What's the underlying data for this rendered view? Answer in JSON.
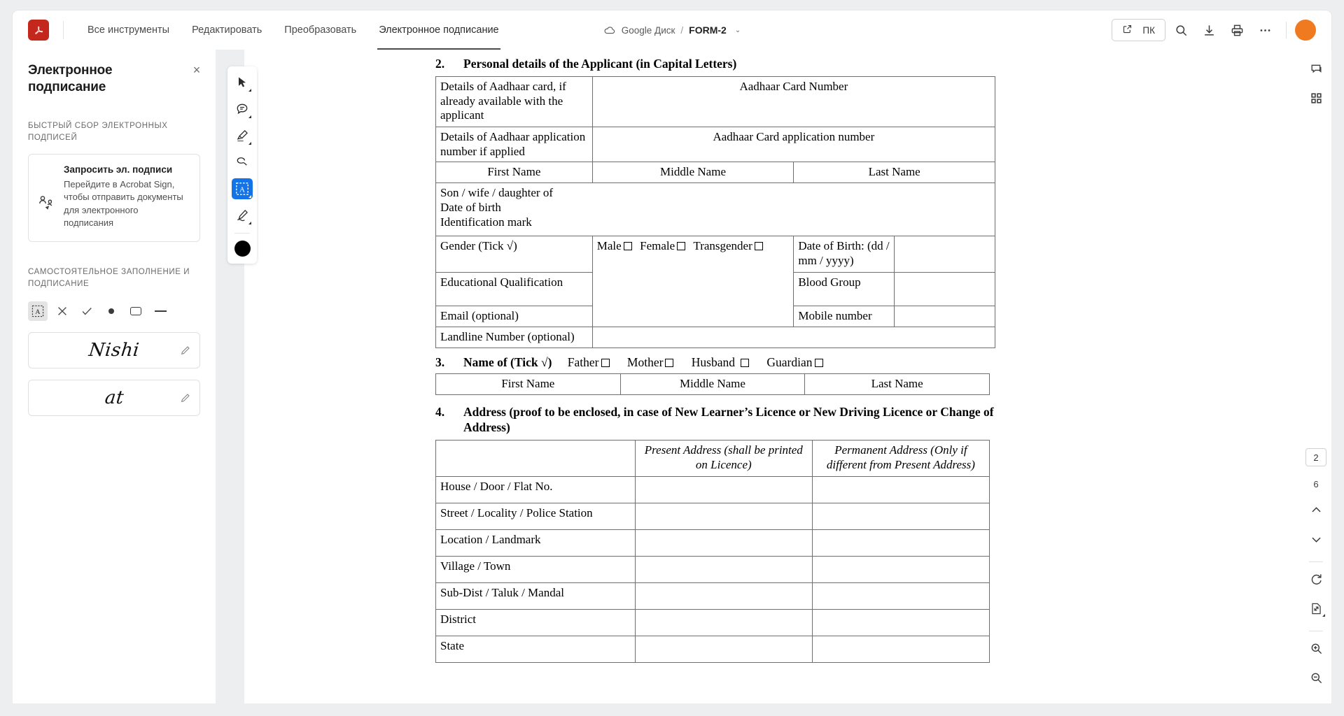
{
  "app": {
    "logo_icon": "acrobat-logo",
    "nav_tabs": [
      {
        "label": "Все инструменты",
        "active": false
      },
      {
        "label": "Редактировать",
        "active": false
      },
      {
        "label": "Преобразовать",
        "active": false
      },
      {
        "label": "Электронное подписание",
        "active": true
      }
    ]
  },
  "breadcrumb": {
    "cloud_icon": "cloud-icon",
    "storage": "Google Диск",
    "separator": "/",
    "filename": "FORM-2",
    "caret": "⌄"
  },
  "toolbar_right": {
    "share_label": "ПК",
    "share_icon": "external-link-icon",
    "search_icon": "search-icon",
    "download_icon": "download-icon",
    "print_icon": "print-icon",
    "more_icon": "more-options-icon",
    "avatar": "user-avatar"
  },
  "left_panel": {
    "title": "Электронное подписание",
    "close_label": "×",
    "section1_title": "БЫСТРЫЙ СБОР ЭЛЕКТРОННЫХ ПОДПИСЕЙ",
    "request_card": {
      "icon": "request-signatures-icon",
      "title": "Запросить эл. подписи",
      "description": "Перейдите в Acrobat Sign, чтобы отправить документы для электронного подписания"
    },
    "section2_title": "САМОСТОЯТЕЛЬНОЕ ЗАПОЛНЕНИЕ И ПОДПИСАНИЕ",
    "fill_tools": [
      {
        "name": "add-text-tool",
        "glyph": "A",
        "active": true
      },
      {
        "name": "cross-mark-tool",
        "glyph": "✕",
        "active": false
      },
      {
        "name": "check-mark-tool",
        "glyph": "✓",
        "active": false
      },
      {
        "name": "dot-tool",
        "glyph": "•",
        "active": false
      },
      {
        "name": "rectangle-tool",
        "glyph": "▭",
        "active": false
      },
      {
        "name": "line-tool",
        "glyph": "—",
        "active": false
      }
    ],
    "signatures": [
      {
        "text": "Nishi",
        "edit_icon": "pencil-icon"
      },
      {
        "text": "at",
        "edit_icon": "pencil-icon"
      }
    ]
  },
  "vertical_toolbar": [
    {
      "name": "select-tool",
      "icon": "cursor-arrow-icon",
      "active": false,
      "has_dropdown": true
    },
    {
      "name": "comment-tool",
      "icon": "comment-bubble-icon",
      "active": false,
      "has_dropdown": true
    },
    {
      "name": "highlight-tool",
      "icon": "highlighter-icon",
      "active": false,
      "has_dropdown": true
    },
    {
      "name": "erase-tool",
      "icon": "lasso-eraser-icon",
      "active": false,
      "has_dropdown": false
    },
    {
      "name": "add-text-tool",
      "icon": "text-box-icon",
      "active": true,
      "has_dropdown": true
    },
    {
      "name": "sign-tool",
      "icon": "fountain-pen-icon",
      "active": false,
      "has_dropdown": true
    },
    {
      "name": "color-swatch",
      "icon": "color-circle",
      "active": false,
      "has_dropdown": false,
      "color": "#000000"
    }
  ],
  "right_rail": {
    "top_icons": [
      {
        "name": "comments-panel-icon",
        "icon": "comment-bubble-icon"
      },
      {
        "name": "page-thumbnails-icon",
        "icon": "grid-icon"
      }
    ],
    "current_page": "2",
    "total_pages": "6",
    "prev_page_icon": "chevron-up-icon",
    "next_page_icon": "chevron-down-icon",
    "rotate_icon": "rotate-clockwise-icon",
    "fit_page_icon": "fit-page-icon",
    "zoom_in_icon": "zoom-in-icon",
    "zoom_out_icon": "zoom-out-icon"
  },
  "document": {
    "section2": {
      "number": "2.",
      "heading": "Personal details of the Applicant (in Capital Letters)",
      "rows": {
        "aadhaar_label": "Details of Aadhaar card, if already available with the applicant",
        "aadhaar_value": "Aadhaar Card Number",
        "aadhaar_app_label": "Details of Aadhaar application number if applied",
        "aadhaar_app_value": "Aadhaar Card application number",
        "name_first": "First Name",
        "name_middle": "Middle Name",
        "name_last": "Last Name",
        "relation_line1": "Son / wife / daughter of",
        "relation_line2": "Date of birth",
        "relation_line3": "Identification mark",
        "gender_label": "Gender (Tick √)",
        "gender_male": "Male",
        "gender_female": "Female",
        "gender_transgender": "Transgender",
        "dob_label": "Date of Birth: (dd / mm / yyyy)",
        "education_label": "Educational Qualification",
        "blood_group_label": "Blood Group",
        "email_label": "Email (optional)",
        "mobile_label": "Mobile number",
        "landline_label": "Landline Number (optional)"
      }
    },
    "section3": {
      "number": "3.",
      "heading": "Name of (Tick √)",
      "options": [
        "Father",
        "Mother",
        "Husband",
        "Guardian"
      ],
      "name_first": "First Name",
      "name_middle": "Middle Name",
      "name_last": "Last Name"
    },
    "section4": {
      "number": "4.",
      "heading": "Address (proof to be enclosed, in case of New Learner’s Licence or New Driving Licence or Change of Address)",
      "col_present": "Present Address (shall be printed on Licence)",
      "col_permanent": "Permanent Address (Only if different from Present Address)",
      "rows": [
        "House / Door / Flat No.",
        "Street / Locality / Police Station",
        "Location / Landmark",
        "Village / Town",
        "Sub-Dist / Taluk / Mandal",
        "District",
        "State"
      ]
    }
  }
}
